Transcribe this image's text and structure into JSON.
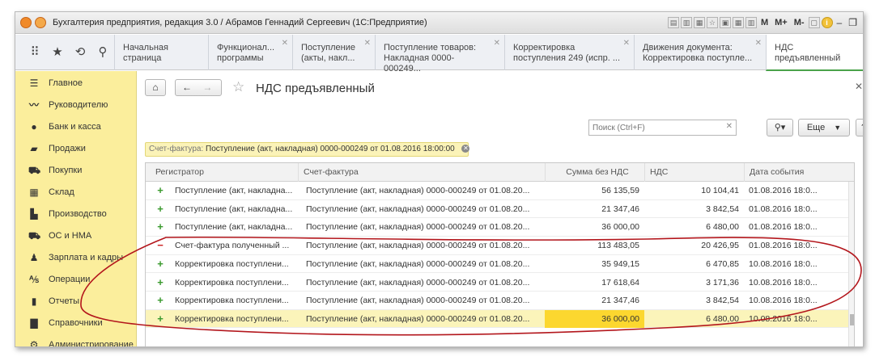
{
  "app": {
    "title": "Бухгалтерия предприятия, редакция 3.0 / Абрамов Геннадий Сергеевич  (1С:Предприятие)",
    "toolbar_letters": [
      "M",
      "M+",
      "M-"
    ]
  },
  "tabs": [
    {
      "label": "Начальная страница",
      "closable": false
    },
    {
      "label": "Функционал... программы",
      "closable": true
    },
    {
      "label": "Поступление (акты, накл...",
      "closable": true
    },
    {
      "label": "Поступление товаров: Накладная 0000-000249...",
      "closable": true
    },
    {
      "label": "Корректировка поступления 249 (испр. ...",
      "closable": true
    },
    {
      "label": "Движения документа: Корректировка поступле...",
      "closable": true
    },
    {
      "label": "НДС предъявленный",
      "closable": false
    }
  ],
  "sidebar": {
    "items": [
      {
        "label": "Главное",
        "icon": "menu-icon"
      },
      {
        "label": "Руководителю",
        "icon": "trend-icon"
      },
      {
        "label": "Банк и касса",
        "icon": "coin-icon"
      },
      {
        "label": "Продажи",
        "icon": "bag-icon"
      },
      {
        "label": "Покупки",
        "icon": "cart-icon"
      },
      {
        "label": "Склад",
        "icon": "warehouse-icon"
      },
      {
        "label": "Производство",
        "icon": "factory-icon"
      },
      {
        "label": "ОС и НМА",
        "icon": "truck-icon"
      },
      {
        "label": "Зарплата и кадры",
        "icon": "person-icon"
      },
      {
        "label": "Операции",
        "icon": "operations-icon"
      },
      {
        "label": "Отчеты",
        "icon": "chart-icon"
      },
      {
        "label": "Справочники",
        "icon": "book-icon"
      },
      {
        "label": "Администрирование",
        "icon": "gear-icon"
      }
    ]
  },
  "page": {
    "title": "НДС предъявленный",
    "search_placeholder": "Поиск (Ctrl+F)",
    "more_label": "Еще",
    "help_label": "?",
    "filter_label": "Счет-фактура:",
    "filter_value": "Поступление (акт, накладная) 0000-000249 от 01.08.2016 18:00:00"
  },
  "table": {
    "columns": [
      "Регистратор",
      "Счет-фактура",
      "Сумма без НДС",
      "НДС",
      "Дата события"
    ],
    "rows": [
      {
        "mark": "+",
        "registrar": "Поступление (акт, накладна...",
        "invoice": "Поступление (акт, накладная) 0000-000249 от 01.08.20...",
        "sum": "56 135,59",
        "vat": "10 104,41",
        "date": "01.08.2016 18:0..."
      },
      {
        "mark": "+",
        "registrar": "Поступление (акт, накладна...",
        "invoice": "Поступление (акт, накладная) 0000-000249 от 01.08.20...",
        "sum": "21 347,46",
        "vat": "3 842,54",
        "date": "01.08.2016 18:0..."
      },
      {
        "mark": "+",
        "registrar": "Поступление (акт, накладна...",
        "invoice": "Поступление (акт, накладная) 0000-000249 от 01.08.20...",
        "sum": "36 000,00",
        "vat": "6 480,00",
        "date": "01.08.2016 18:0..."
      },
      {
        "mark": "−",
        "registrar": "Счет-фактура полученный ...",
        "invoice": "Поступление (акт, накладная) 0000-000249 от 01.08.20...",
        "sum": "113 483,05",
        "vat": "20 426,95",
        "date": "01.08.2016 18:0..."
      },
      {
        "mark": "+",
        "registrar": "Корректировка поступлени...",
        "invoice": "Поступление (акт, накладная) 0000-000249 от 01.08.20...",
        "sum": "35 949,15",
        "vat": "6 470,85",
        "date": "10.08.2016 18:0..."
      },
      {
        "mark": "+",
        "registrar": "Корректировка поступлени...",
        "invoice": "Поступление (акт, накладная) 0000-000249 от 01.08.20...",
        "sum": "17 618,64",
        "vat": "3 171,36",
        "date": "10.08.2016 18:0..."
      },
      {
        "mark": "+",
        "registrar": "Корректировка поступлени...",
        "invoice": "Поступление (акт, накладная) 0000-000249 от 01.08.20...",
        "sum": "21 347,46",
        "vat": "3 842,54",
        "date": "10.08.2016 18:0..."
      },
      {
        "mark": "+",
        "registrar": "Корректировка поступлени...",
        "invoice": "Поступление (акт, накладная) 0000-000249 от 01.08.20...",
        "sum": "36 000,00",
        "vat": "6 480,00",
        "date": "10.08.2016 18:0..."
      }
    ],
    "selected_row": 7
  },
  "colors": {
    "sidebar_bg": "#fbee9c",
    "plus_mark": "#3a9a2e",
    "minus_mark": "#cc2222",
    "selected_row": "#fbf4ba",
    "highlight_cell": "#fcd72f",
    "annotation_stroke": "#b3161c",
    "active_tab_underline": "#4aa24a"
  }
}
